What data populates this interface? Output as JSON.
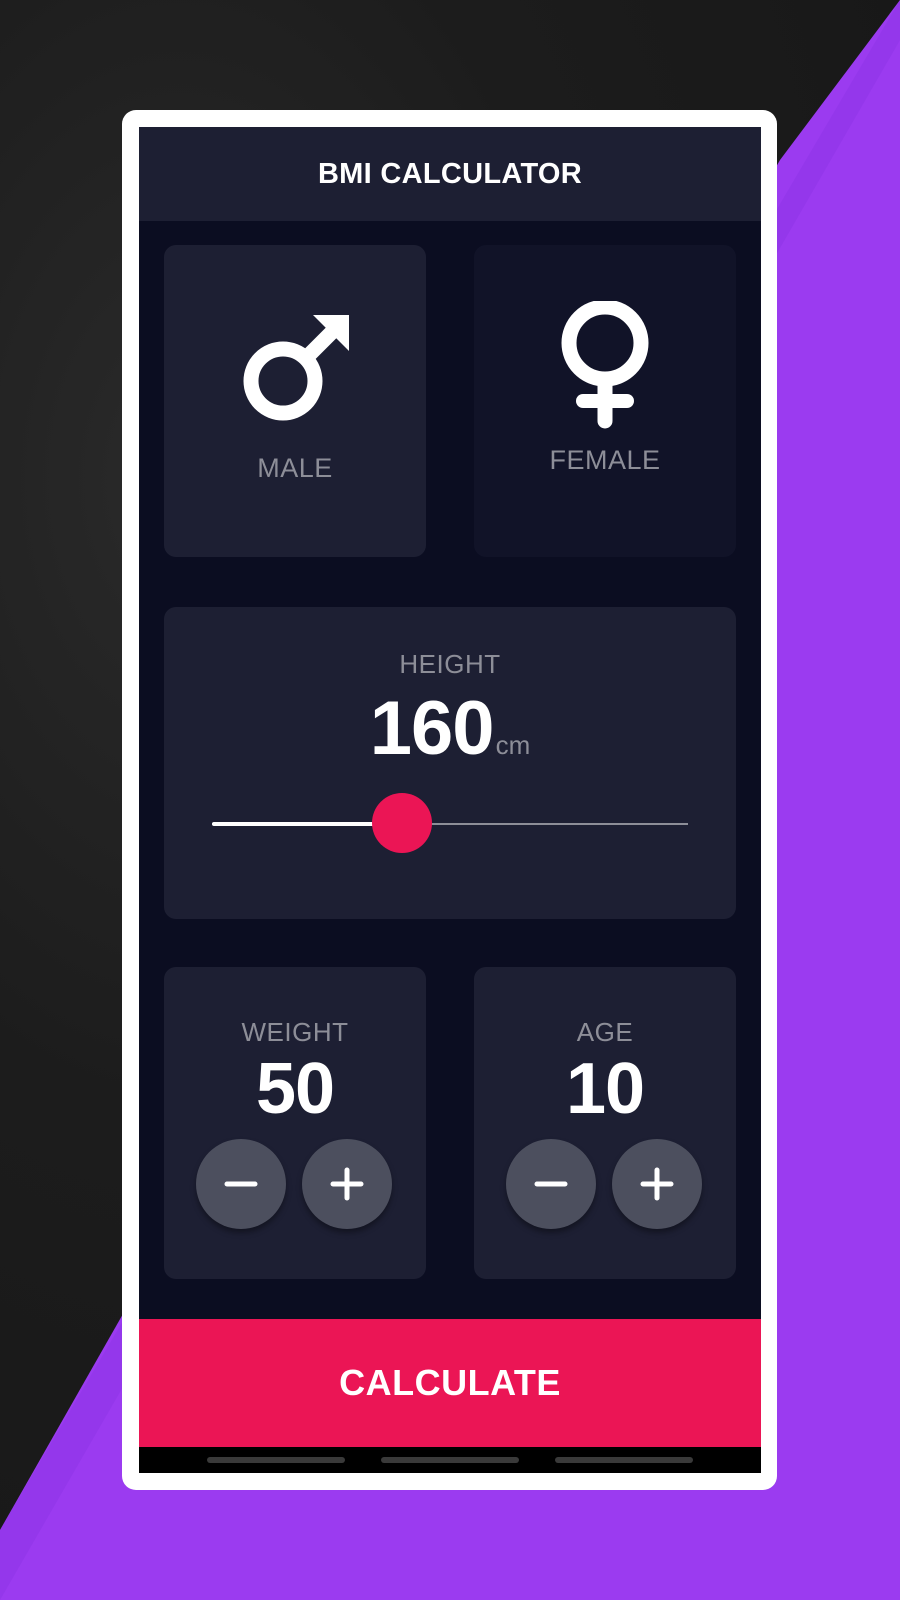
{
  "app_title": "BMI CALCULATOR",
  "gender": {
    "male_label": "MALE",
    "female_label": "FEMALE",
    "selected": "male"
  },
  "height": {
    "label": "HEIGHT",
    "value": "160",
    "unit": "cm",
    "slider_fraction": 0.4
  },
  "weight": {
    "label": "WEIGHT",
    "value": "50"
  },
  "age": {
    "label": "AGE",
    "value": "10"
  },
  "calculate_label": "CALCULATE",
  "colors": {
    "accent": "#eb1555",
    "card_active": "#1d1f33",
    "card_inactive": "#111328",
    "background": "#0b0d21",
    "label": "#8d8e98",
    "button": "#4c4f5e",
    "backdrop_purple": "#9b3bf0"
  },
  "icons": {
    "male": "male-symbol-icon",
    "female": "female-symbol-icon",
    "minus": "minus-icon",
    "plus": "plus-icon"
  }
}
